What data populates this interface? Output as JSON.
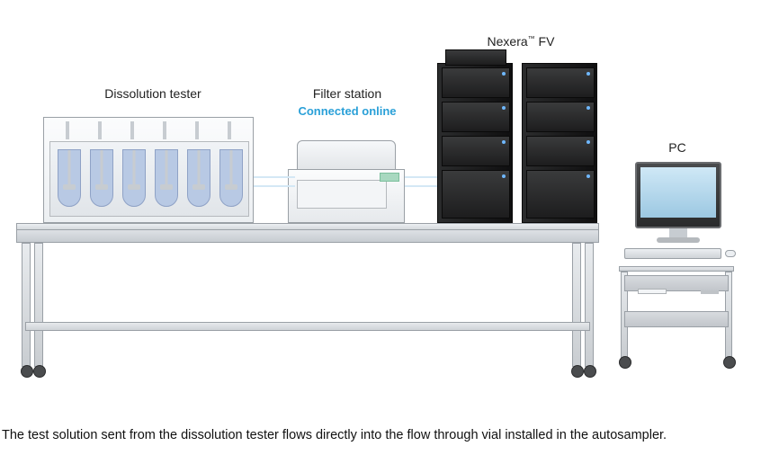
{
  "labels": {
    "dissolution_tester": "Dissolution tester",
    "filter_station": "Filter station",
    "connected_online": "Connected online",
    "nexera_fv_pre": "Nexera",
    "nexera_fv_tm": "™",
    "nexera_fv_post": " FV",
    "pc": "PC"
  },
  "caption": "The test solution sent from the dissolution tester flows directly into the flow through vial installed in the autosampler.",
  "diagram": {
    "vessel_count": 6,
    "flow_direction": "dissolution_tester → filter_station → nexera_fv",
    "components": [
      "dissolution_tester",
      "filter_station",
      "nexera_fv",
      "pc"
    ]
  },
  "colors": {
    "accent": "#2aa0d8",
    "vessel_fill": "#b8c9e4",
    "instrument_dark": "#1a1a1b"
  }
}
